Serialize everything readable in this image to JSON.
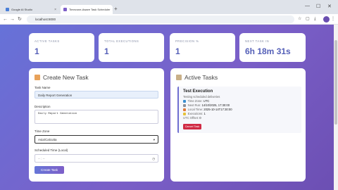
{
  "browser": {
    "tabs": [
      {
        "title": "Google AI Studio"
      },
      {
        "title": "Timezone-Aware Task Scheduler"
      }
    ],
    "new_tab_symbol": "+",
    "address": "localhost:8000",
    "window_controls": [
      "—",
      "☐",
      "✕"
    ]
  },
  "stats": [
    {
      "label": "ACTIVE TASKS",
      "value": "1"
    },
    {
      "label": "TOTAL EXECUTIONS",
      "value": "1"
    },
    {
      "label": "PRECISION %",
      "value": "1"
    },
    {
      "label": "NEXT TASK IN",
      "value": "6h 18m 31s"
    }
  ],
  "create_panel": {
    "title": "Create New Task",
    "task_name_label": "Task Name",
    "task_name_value": "Daily Report Generation",
    "description_label": "Description",
    "description_value": "Daily Report Generation",
    "timezone_label": "Time Zone",
    "timezone_value": "Asia/Calcutta",
    "scheduled_label": "Scheduled Time (Local)",
    "scheduled_placeholder": "-- : --",
    "submit_label": "Create Task"
  },
  "active_panel": {
    "title": "Active Tasks",
    "task": {
      "title": "Test Execution",
      "subtitle": "Testing scheduled deliveries",
      "time_zone_label": "Time Zone:",
      "time_zone_value": "UTC",
      "next_run_label": "Next Run:",
      "next_run_value": "14/10/2025, 17:30:00",
      "local_time_label": "Local Time:",
      "local_time_value": "2025-10-14T17:30:00",
      "executions_label": "Executions:",
      "executions_value": "1",
      "utc_offset_label": "UTC Offset:",
      "utc_offset_value": "0",
      "cancel_label": "Cancel Task"
    }
  },
  "colors": {
    "gradient_start": "#6672d8",
    "gradient_end": "#6c4fb3",
    "accent": "#5560b8",
    "cancel": "#d02a44"
  }
}
